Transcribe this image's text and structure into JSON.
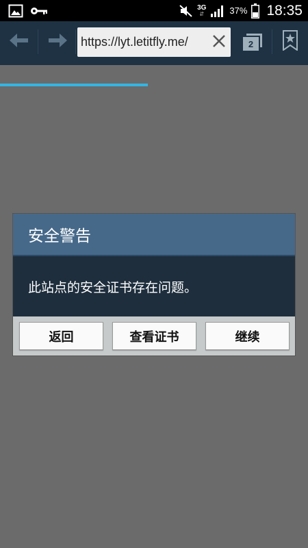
{
  "status_bar": {
    "left_icons": [
      "gallery-icon",
      "key-icon"
    ],
    "network_label": "3G",
    "network_arrows": "⇵",
    "battery_percent": "37%",
    "time": "18:35"
  },
  "toolbar": {
    "back_icon": "arrow-left-icon",
    "forward_icon": "arrow-right-icon",
    "url": "https://lyt.letitfly.me/",
    "clear_icon": "close-icon",
    "tab_count": "2",
    "bookmark_icon": "bookmark-star-icon",
    "page_load_progress": 0.48
  },
  "dialog": {
    "title": "安全警告",
    "message": "此站点的安全证书存在问题。",
    "buttons": {
      "back": "返回",
      "view_certificate": "查看证书",
      "continue": "继续"
    }
  },
  "colors": {
    "toolbar_bg": "#1e3244",
    "dialog_header": "#46698a",
    "dialog_body": "#1e2e3d",
    "progress": "#33b5e5",
    "page_bg": "#6b6b6b"
  }
}
